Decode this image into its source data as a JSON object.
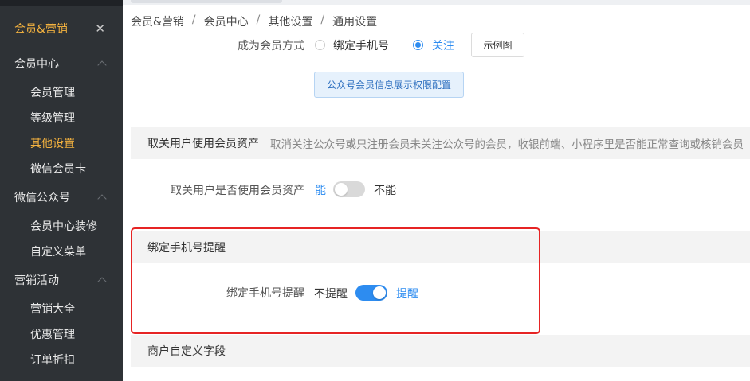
{
  "sidebar": {
    "header_title": "会员&营销",
    "groups": [
      {
        "label": "会员中心",
        "items": [
          "会员管理",
          "等级管理",
          "其他设置",
          "微信会员卡"
        ]
      },
      {
        "label": "微信公众号",
        "items": [
          "会员中心装修",
          "自定义菜单"
        ]
      },
      {
        "label": "营销活动",
        "items": [
          "营销大全",
          "优惠管理",
          "订单折扣"
        ]
      }
    ],
    "active_item": "其他设置"
  },
  "breadcrumb": [
    "会员&营销",
    "会员中心",
    "其他设置",
    "通用设置"
  ],
  "member_mode": {
    "label": "成为会员方式",
    "options": [
      "绑定手机号",
      "关注"
    ],
    "selected": "关注",
    "example_button": "示例图",
    "permission_button": "公众号会员信息展示权限配置"
  },
  "unfollow_section": {
    "title": "取关用户使用会员资产",
    "description": "取消关注公众号或只注册会员未关注公众号的会员，收银前端、小程序里是否能正常查询或核销会员",
    "row_label": "取关用户是否使用会员资产",
    "left_option": "能",
    "right_option": "不能",
    "switch_on": false
  },
  "bind_phone_section": {
    "title": "绑定手机号提醒",
    "row_label": "绑定手机号提醒",
    "left_option": "不提醒",
    "right_option": "提醒",
    "switch_on": true
  },
  "custom_fields_section": {
    "title": "商户自定义字段"
  },
  "colors": {
    "accent": "#2d8cf0",
    "sidebar_bg": "#2e3236",
    "sidebar_active": "#f5b33f",
    "highlight_box": "#e62424"
  }
}
